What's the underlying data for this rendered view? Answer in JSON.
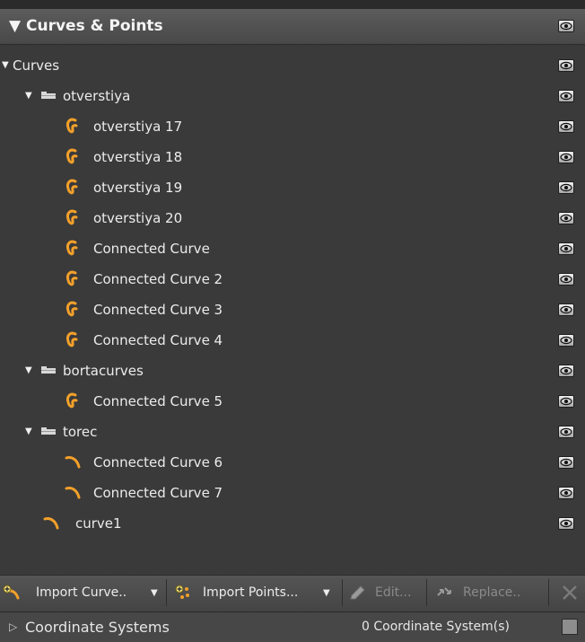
{
  "panel": {
    "title_arrow": "▼",
    "title": "Curves & Points"
  },
  "tree": {
    "root": {
      "label": "Curves",
      "expanded": true
    },
    "folders": [
      {
        "label": "otverstiya",
        "expanded": true
      },
      {
        "label": "bortacurves",
        "expanded": true
      },
      {
        "label": "torec",
        "expanded": true
      }
    ],
    "items": [
      {
        "label": "otverstiya 17",
        "icon": "closed-curve-icon"
      },
      {
        "label": "otverstiya 18",
        "icon": "closed-curve-icon"
      },
      {
        "label": "otverstiya 19",
        "icon": "closed-curve-icon"
      },
      {
        "label": "otverstiya 20",
        "icon": "closed-curve-icon"
      },
      {
        "label": "Connected Curve",
        "icon": "closed-curve-icon"
      },
      {
        "label": "Connected Curve 2",
        "icon": "closed-curve-icon"
      },
      {
        "label": "Connected Curve 3",
        "icon": "closed-curve-icon"
      },
      {
        "label": "Connected Curve 4",
        "icon": "closed-curve-icon"
      },
      {
        "label": "Connected Curve 5",
        "icon": "closed-curve-icon"
      },
      {
        "label": "Connected Curve 6",
        "icon": "open-curve-icon"
      },
      {
        "label": "Connected Curve 7",
        "icon": "open-curve-icon"
      },
      {
        "label": "curve1",
        "icon": "open-curve-icon"
      }
    ]
  },
  "toolbar": {
    "import_curve": "Import Curve..",
    "import_points": "Import Points...",
    "edit": "Edit...",
    "replace": "Replace.."
  },
  "coordinate_systems": {
    "title": "Coordinate Systems",
    "count": "0 Coordinate System(s)"
  },
  "colors": {
    "curve_icon": "#f2a02a",
    "panel_bg": "#3a3a3a",
    "header_bg": "#525252"
  }
}
